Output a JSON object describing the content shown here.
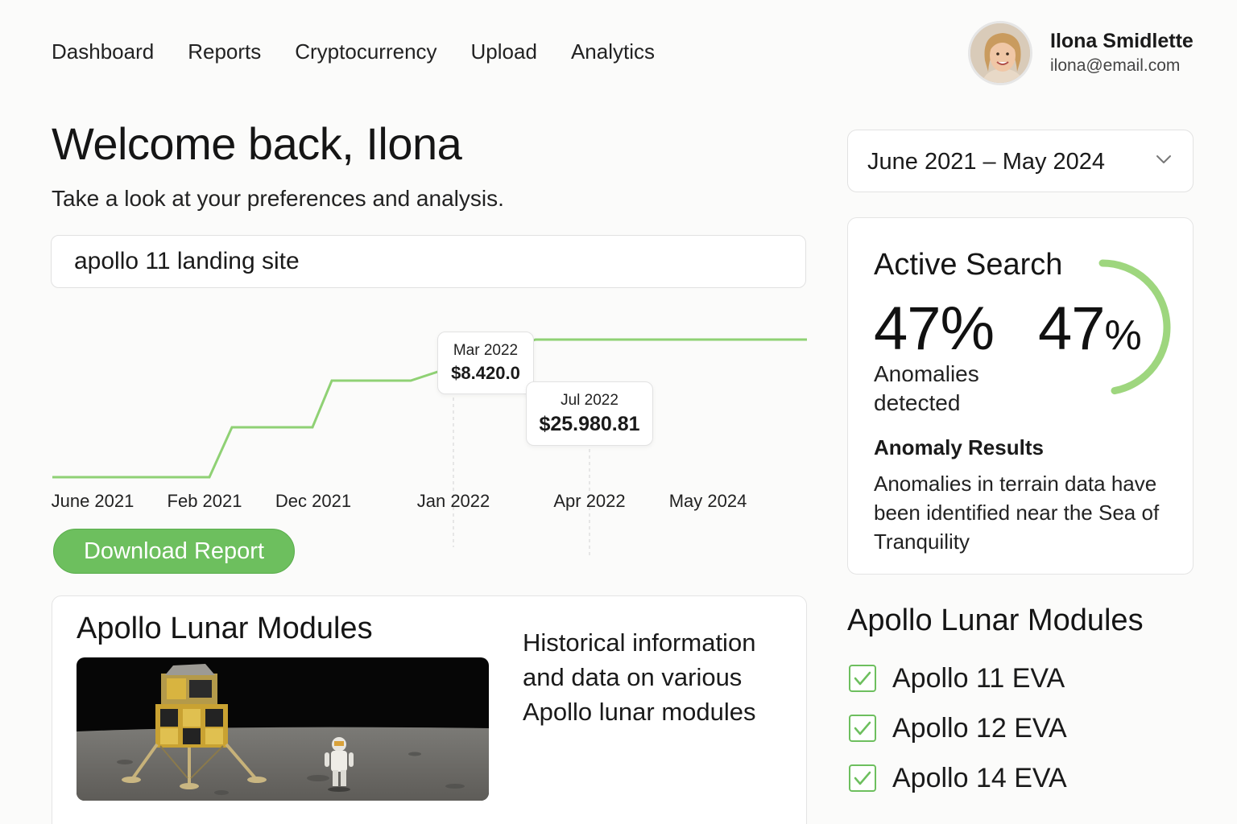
{
  "nav": {
    "items": [
      {
        "label": "Dashboard"
      },
      {
        "label": "Reports"
      },
      {
        "label": "Cryptocurrency"
      },
      {
        "label": "Upload"
      },
      {
        "label": "Analytics"
      }
    ]
  },
  "user": {
    "name": "Ilona Smidlette",
    "email": "ilona@email.com"
  },
  "header": {
    "welcome": "Welcome back, Ilona",
    "subtitle": "Take a look at your preferences and analysis."
  },
  "search": {
    "value": "apollo 11 landing site"
  },
  "chart_data": {
    "type": "line",
    "style": "step",
    "color": "#8fd174",
    "x_ticks": [
      "June 2021",
      "Feb 2021",
      "Dec 2021",
      "Jan 2022",
      "Apr 2022",
      "May 2024"
    ],
    "y": [
      0,
      0,
      1,
      1,
      2,
      2,
      3,
      3,
      3,
      3
    ],
    "tooltips": [
      {
        "date": "Mar 2022",
        "value": "$8.420.0"
      },
      {
        "date": "Jul 2022",
        "value": "$25.980.81"
      }
    ]
  },
  "actions": {
    "download_label": "Download Report"
  },
  "modules_card": {
    "title": "Apollo Lunar Modules",
    "description": "Historical information and data on various Apollo lunar modules"
  },
  "date_range": {
    "label": "June 2021 – May 2024"
  },
  "active_search": {
    "title": "Active Search",
    "value": "47%",
    "ring_value": "47",
    "ring_unit": "%",
    "ring_fraction": 0.47,
    "caption": "Anomalies detected",
    "results_title": "Anomaly Results",
    "results_body": "Anomalies in terrain data have been identified near the Sea of Tranquility"
  },
  "checklist": {
    "title": "Apollo Lunar Modules",
    "items": [
      {
        "label": "Apollo 11 EVA",
        "checked": true
      },
      {
        "label": "Apollo 12 EVA",
        "checked": true
      },
      {
        "label": "Apollo 14 EVA",
        "checked": true
      }
    ]
  },
  "colors": {
    "accent": "#6dbf5e",
    "chart_line": "#8fd174",
    "ring": "#9ed67e"
  }
}
